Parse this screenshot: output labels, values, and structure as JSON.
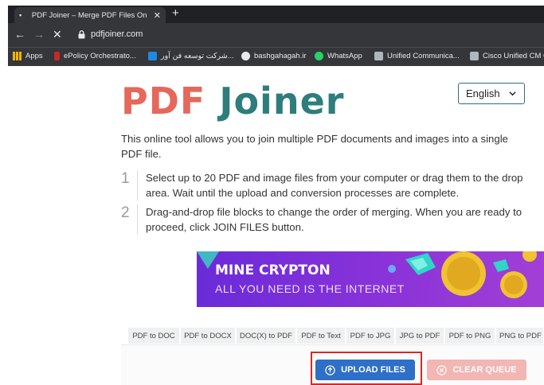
{
  "browser": {
    "tab_title": "PDF Joiner – Merge PDF Files On",
    "new_tab": "+",
    "url": "pdfjoiner.com",
    "bookmarks": [
      {
        "label": "Apps",
        "color": "#f4b400"
      },
      {
        "label": "ePolicy Orchestrato...",
        "color": "#c62828"
      },
      {
        "label": "شرکت توسعه فن آور...",
        "color": "#1e88e5"
      },
      {
        "label": "bashgahagah.ir",
        "color": "#e8eaed"
      },
      {
        "label": "WhatsApp",
        "color": "#25d366"
      },
      {
        "label": "Unified Communica...",
        "color": "#b0b6bd"
      },
      {
        "label": "Cisco Unified CM C",
        "color": "#b0b6bd"
      }
    ]
  },
  "header": {
    "logo_part1": "PDF",
    "logo_part2": "Joiner",
    "language": "English"
  },
  "intro": "This online tool allows you to join multiple PDF documents and images into a single PDF file.",
  "steps": [
    {
      "num": "1",
      "text": "Select up to 20 PDF and image files from your computer or drag them to the drop area. Wait until the upload and conversion processes are complete."
    },
    {
      "num": "2",
      "text": "Drag-and-drop file blocks to change the order of merging. When you are ready to proceed, click JOIN FILES button."
    }
  ],
  "ad": {
    "headline": "MINE CRYPTON",
    "subline": "ALL YOU NEED IS THE INTERNET"
  },
  "tool_tabs": [
    "PDF to DOC",
    "PDF to DOCX",
    "DOC(X) to PDF",
    "PDF to Text",
    "PDF to JPG",
    "JPG to PDF",
    "PDF to PNG",
    "PNG to PDF"
  ],
  "actions": {
    "upload": "UPLOAD FILES",
    "clear": "CLEAR QUEUE"
  },
  "colors": {
    "logo_red": "#e5685a",
    "logo_teal": "#2e7d7d",
    "upload_blue": "#2e6fc7",
    "clear_pink": "#f2b6b3",
    "highlight_red": "#d62828"
  }
}
